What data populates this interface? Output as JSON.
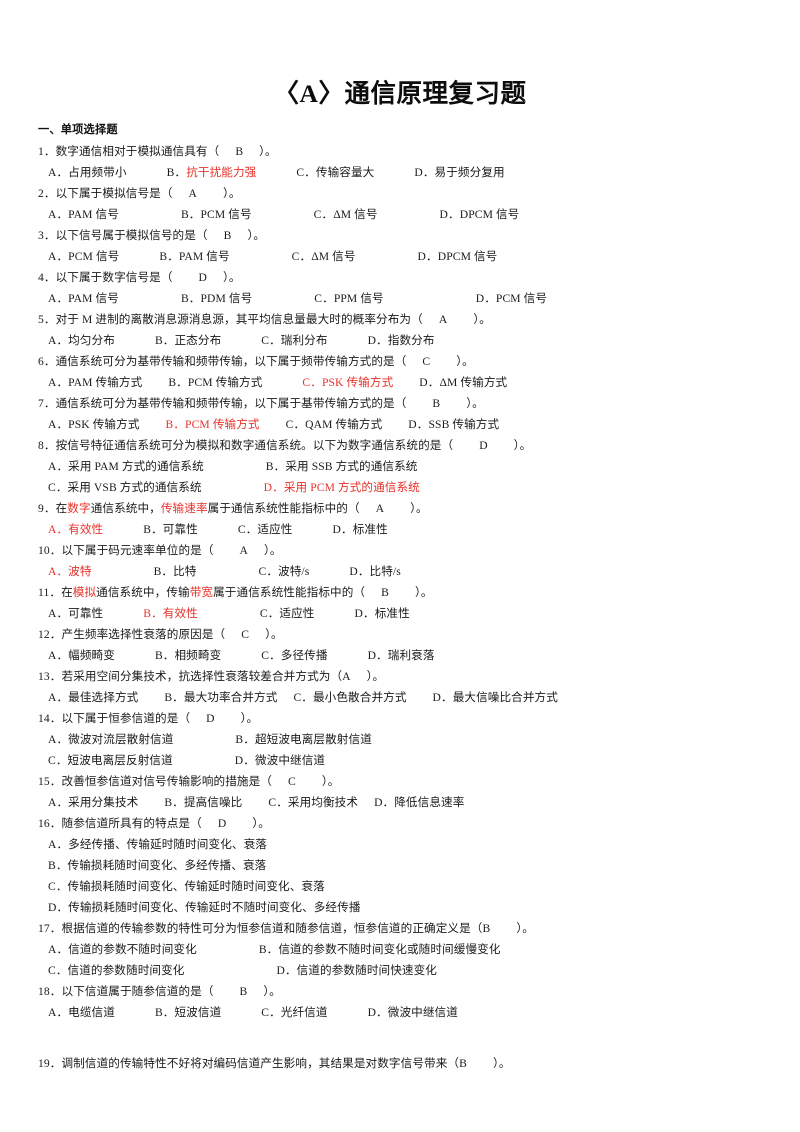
{
  "document": {
    "title": "〈A〉通信原理复习题",
    "section_heading": "一、单项选择题",
    "accent_color": "#e8312a",
    "text_color": "#1a1a1a",
    "background": "#ffffff"
  },
  "questions": [
    {
      "number": "1．",
      "stem_pre": "数字通信相对于模拟通信具有（",
      "answer": "B",
      "stem_post": "）。",
      "options": [
        {
          "label": "A．",
          "text": "占用频带小",
          "highlight": false
        },
        {
          "label": "B．",
          "text": "抗干扰能力强",
          "highlight": true
        },
        {
          "label": "C．",
          "text": "传输容量大",
          "highlight": false
        },
        {
          "label": "D．",
          "text": "易于频分复用",
          "highlight": false
        }
      ]
    },
    {
      "number": "2．",
      "stem_pre": "以下属于模拟信号是（",
      "answer": "A",
      "stem_post": "）。",
      "options": [
        {
          "label": "A．",
          "text": "PAM 信号",
          "highlight": false
        },
        {
          "label": "B．",
          "text": "PCM 信号",
          "highlight": false
        },
        {
          "label": "C．",
          "text": "ΔM 信号",
          "highlight": false
        },
        {
          "label": "D．",
          "text": "DPCM 信号",
          "highlight": false
        }
      ]
    },
    {
      "number": "3．",
      "stem_pre": "以下信号属于模拟信号的是（",
      "answer": "B",
      "stem_post": "）。",
      "options": [
        {
          "label": "A．",
          "text": "PCM 信号",
          "highlight": false
        },
        {
          "label": "B．",
          "text": "PAM 信号",
          "highlight": false
        },
        {
          "label": "C．",
          "text": "ΔM 信号",
          "highlight": false
        },
        {
          "label": "D．",
          "text": "DPCM 信号",
          "highlight": false
        }
      ]
    },
    {
      "number": "4．",
      "stem_pre": "以下属于数字信号是（",
      "answer": "D",
      "stem_post": "）。",
      "options": [
        {
          "label": "A．",
          "text": "PAM 信号",
          "highlight": false
        },
        {
          "label": "B．",
          "text": "PDM 信号",
          "highlight": false
        },
        {
          "label": "C．",
          "text": "PPM 信号",
          "highlight": false
        },
        {
          "label": "D．",
          "text": "PCM 信号",
          "highlight": false
        }
      ]
    },
    {
      "number": "5．",
      "stem_pre": "对于 M 进制的离散消息源消息源，其平均信息量最大时的概率分布为（",
      "answer": "A",
      "stem_post": "）。",
      "options": [
        {
          "label": "A．",
          "text": "均匀分布",
          "highlight": false
        },
        {
          "label": "B．",
          "text": "正态分布",
          "highlight": false
        },
        {
          "label": "C．",
          "text": "瑞利分布",
          "highlight": false
        },
        {
          "label": "D．",
          "text": "指数分布",
          "highlight": false
        }
      ]
    },
    {
      "number": "6．",
      "stem_pre": "通信系统可分为基带传输和频带传输，以下属于频带传输方式的是（",
      "answer": "C",
      "stem_post": "）。",
      "options": [
        {
          "label": "A．",
          "text": "PAM 传输方式",
          "highlight": false
        },
        {
          "label": "B．",
          "text": "PCM 传输方式",
          "highlight": false
        },
        {
          "label": "C．",
          "text": "PSK 传输方式",
          "highlight": true
        },
        {
          "label": "D．",
          "text": "ΔM 传输方式",
          "highlight": false
        }
      ]
    },
    {
      "number": "7．",
      "stem_pre": "通信系统可分为基带传输和频带传输，以下属于基带传输方式的是（",
      "answer": "B",
      "stem_post": "）。",
      "options": [
        {
          "label": "A．",
          "text": "PSK 传输方式",
          "highlight": false
        },
        {
          "label": "B．",
          "text": "PCM 传输方式",
          "highlight": true
        },
        {
          "label": "C．",
          "text": "QAM 传输方式",
          "highlight": false
        },
        {
          "label": "D．",
          "text": "SSB 传输方式",
          "highlight": false
        }
      ]
    },
    {
      "number": "8．",
      "stem_pre": "按信号特征通信系统可分为模拟和数字通信系统。以下为数字通信系统的是（",
      "answer": "D",
      "stem_post": "）。",
      "options": [
        {
          "label": "A．",
          "text": "采用 PAM 方式的通信系统",
          "highlight": false
        },
        {
          "label": "B．",
          "text": "采用 SSB 方式的通信系统",
          "highlight": false
        },
        {
          "label": "C．",
          "text": "采用 VSB 方式的通信系统",
          "highlight": false
        },
        {
          "label": "D．",
          "text": "采用 PCM 方式的通信系统",
          "highlight": true
        }
      ]
    },
    {
      "number": "9．",
      "stem_pre": "在",
      "stem_hl1": "数字",
      "stem_mid": "通信系统中，",
      "stem_hl2": "传输速率",
      "stem_tail": "属于通信系统性能指标中的（",
      "answer": "A",
      "stem_post": "）。",
      "options": [
        {
          "label": "A．",
          "text": "有效性",
          "highlight": true
        },
        {
          "label": "B．",
          "text": "可靠性",
          "highlight": false
        },
        {
          "label": "C．",
          "text": "适应性",
          "highlight": false
        },
        {
          "label": "D．",
          "text": "标准性",
          "highlight": false
        }
      ]
    },
    {
      "number": "10．",
      "stem_pre": "以下属于码元速率单位的是（",
      "answer": "A",
      "stem_post": "）。",
      "options": [
        {
          "label": "A．",
          "text": "波特",
          "highlight": true
        },
        {
          "label": "B．",
          "text": "比特",
          "highlight": false
        },
        {
          "label": "C．",
          "text": "波特/s",
          "highlight": false
        },
        {
          "label": "D．",
          "text": "比特/s",
          "highlight": false
        }
      ]
    },
    {
      "number": "11．",
      "stem_pre": "在",
      "stem_hl1": "模拟",
      "stem_mid": "通信系统中，传输",
      "stem_hl2": "带宽",
      "stem_tail": "属于通信系统性能指标中的（",
      "answer": "B",
      "stem_post": "）。",
      "options": [
        {
          "label": "A．",
          "text": "可靠性",
          "highlight": false
        },
        {
          "label": "B．",
          "text": "有效性",
          "highlight": true
        },
        {
          "label": "C．",
          "text": "适应性",
          "highlight": false
        },
        {
          "label": "D．",
          "text": "标准性",
          "highlight": false
        }
      ]
    },
    {
      "number": "12．",
      "stem_pre": "产生频率选择性衰落的原因是（",
      "answer": "C",
      "stem_post": "）。",
      "options": [
        {
          "label": "A．",
          "text": "幅频畸变",
          "highlight": false
        },
        {
          "label": "B．",
          "text": "相频畸变",
          "highlight": false
        },
        {
          "label": "C．",
          "text": "多径传播",
          "highlight": false
        },
        {
          "label": "D．",
          "text": "瑞利衰落",
          "highlight": false
        }
      ]
    },
    {
      "number": "13．",
      "stem_pre": "若采用空间分集技术，抗选择性衰落较差合并方式为（",
      "answer": "A",
      "stem_post": "）。",
      "options": [
        {
          "label": "A．",
          "text": "最佳选择方式",
          "highlight": false
        },
        {
          "label": "B．",
          "text": "最大功率合并方式",
          "highlight": false
        },
        {
          "label": "C．",
          "text": "最小色散合并方式",
          "highlight": false
        },
        {
          "label": "D．",
          "text": "最大信噪比合并方式",
          "highlight": false
        }
      ]
    },
    {
      "number": "14．",
      "stem_pre": "以下属于恒参信道的是（",
      "answer": "D",
      "stem_post": "）。",
      "options": [
        {
          "label": "A．",
          "text": "微波对流层散射信道",
          "highlight": false
        },
        {
          "label": "B．",
          "text": "超短波电离层散射信道",
          "highlight": false
        },
        {
          "label": "C．",
          "text": "短波电离层反射信道",
          "highlight": false
        },
        {
          "label": "D．",
          "text": "微波中继信道",
          "highlight": false
        }
      ]
    },
    {
      "number": "15．",
      "stem_pre": "改善恒参信道对信号传输影响的措施是（",
      "answer": "C",
      "stem_post": "）。",
      "options": [
        {
          "label": "A．",
          "text": "采用分集技术",
          "highlight": false
        },
        {
          "label": "B．",
          "text": "提高信噪比",
          "highlight": false
        },
        {
          "label": "C．",
          "text": "采用均衡技术",
          "highlight": false
        },
        {
          "label": "D．",
          "text": "降低信息速率",
          "highlight": false
        }
      ]
    },
    {
      "number": "16．",
      "stem_pre": "随参信道所具有的特点是（",
      "answer": "D",
      "stem_post": "）。",
      "options": [
        {
          "label": "A．",
          "text": "多经传播、传输延时随时间变化、衰落",
          "highlight": false
        },
        {
          "label": "B．",
          "text": "传输损耗随时间变化、多经传播、衰落",
          "highlight": false
        },
        {
          "label": "C．",
          "text": "传输损耗随时间变化、传输延时随时间变化、衰落",
          "highlight": false
        },
        {
          "label": "D．",
          "text": "传输损耗随时间变化、传输延时不随时间变化、多经传播",
          "highlight": false
        }
      ]
    },
    {
      "number": "17．",
      "stem_pre": "根据信道的传输参数的特性可分为恒参信道和随参信道，恒参信道的正确定义是（",
      "answer": "B",
      "stem_post": "）。",
      "options": [
        {
          "label": "A．",
          "text": "信道的参数不随时间变化",
          "highlight": false
        },
        {
          "label": "B．",
          "text": "信道的参数不随时间变化或随时间缓慢变化",
          "highlight": false
        },
        {
          "label": "C．",
          "text": "信道的参数随时间变化",
          "highlight": false
        },
        {
          "label": "D．",
          "text": "信道的参数随时间快速变化",
          "highlight": false
        }
      ]
    },
    {
      "number": "18．",
      "stem_pre": "以下信道属于随参信道的是（",
      "answer": "B",
      "stem_post": "）。",
      "options": [
        {
          "label": "A．",
          "text": "电缆信道",
          "highlight": false
        },
        {
          "label": "B．",
          "text": "短波信道",
          "highlight": false
        },
        {
          "label": "C．",
          "text": "光纤信道",
          "highlight": false
        },
        {
          "label": "D．",
          "text": "微波中继信道",
          "highlight": false
        }
      ]
    },
    {
      "number": "19．",
      "stem_pre": "调制信道的传输特性不好将对编码信道产生影响，其结果是对数字信号带来（",
      "answer": "B",
      "stem_post": "）。",
      "options": []
    }
  ]
}
